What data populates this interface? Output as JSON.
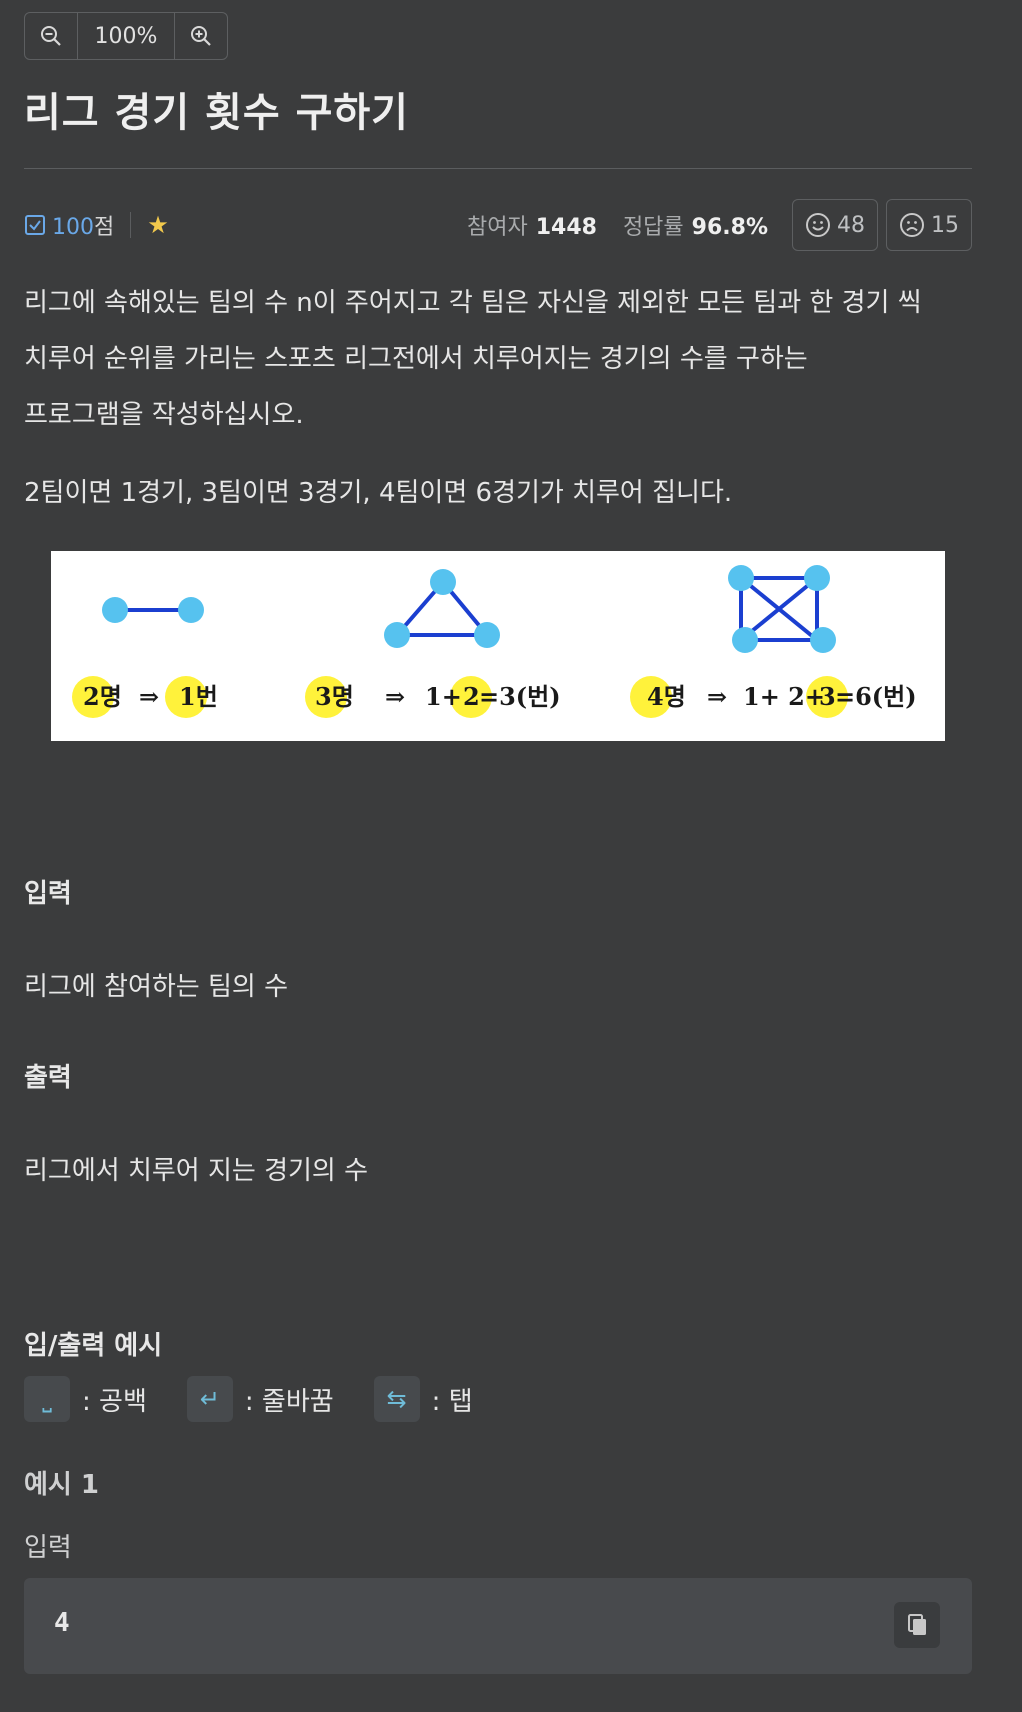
{
  "zoom": {
    "level": "100%",
    "zoom_out_icon": "zoom-out-icon",
    "zoom_in_icon": "zoom-in-icon"
  },
  "problem": {
    "title": "리그 경기 횟수 구하기",
    "score_value": "100",
    "score_suffix": "점",
    "participants_label": "참여자",
    "participants_value": "1448",
    "accuracy_label": "정답률",
    "accuracy_value": "96.8%",
    "likes": "48",
    "dislikes": "15"
  },
  "description": {
    "line1": "리그에 속해있는 팀의 수 n이 주어지고 각 팀은 자신을 제외한 모든 팀과 한 경기 씩",
    "line2": "치루어 순위를 가리는 스포츠 리그전에서 치루어지는 경기의 수를 구하는",
    "line3": "프로그램을 작성하십시오.",
    "line4": "2팀이면 1경기, 3팀이면 3경기, 4팀이면 6경기가 치루어 집니다."
  },
  "figure": {
    "caption1": {
      "people": "2명",
      "arrow": "⇒",
      "result": "1번"
    },
    "caption2": {
      "people": "3명",
      "arrow": "⇒",
      "t1": "1+",
      "t2": "2",
      "eq": "=3(번)"
    },
    "caption3": {
      "people": "4명",
      "arrow": "⇒",
      "t1": "1+ 2+",
      "t3": "3",
      "eq": "=6(번)"
    }
  },
  "input": {
    "heading": "입력",
    "text": "리그에 참여하는 팀의 수"
  },
  "output": {
    "heading": "출력",
    "text": "리그에서 치루어 지는 경기의 수"
  },
  "io_examples": {
    "heading": "입/출력 예시",
    "legend": [
      {
        "icon": "space-icon",
        "glyph": "⎵",
        "label": ": 공백"
      },
      {
        "icon": "newline-icon",
        "glyph": "↵",
        "label": ": 줄바꿈"
      },
      {
        "icon": "tab-icon",
        "glyph": "⇆",
        "label": ": 탭"
      }
    ],
    "example_title": "예시 1",
    "input_label": "입력",
    "input_value": "4"
  },
  "colors": {
    "background": "#3b3c3d",
    "accent_blue": "#6aa8e8",
    "star": "#f2c94c",
    "node": "#56c2ef",
    "highlight": "#fff23b"
  }
}
